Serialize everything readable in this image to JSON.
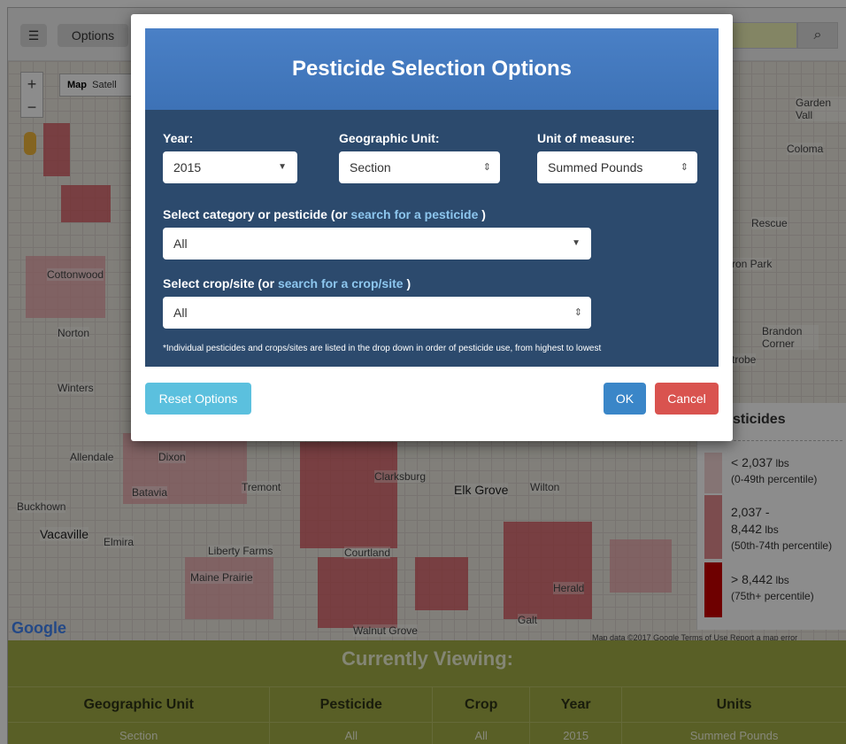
{
  "toolbar": {
    "options_label": "Options",
    "options_icon": "list-icon",
    "search_icon": "search-icon"
  },
  "map": {
    "zoom_in": "+",
    "zoom_out": "−",
    "map_type_map": "Map",
    "map_type_satellite": "Satell",
    "labels": [
      "Garden Vall",
      "Coloma",
      "Rescue",
      "ron Park",
      "Brandon Corner",
      "trobe",
      "Cottonwood",
      "Norton",
      "Winters",
      "Allendale",
      "Dixon",
      "Batavia",
      "Tremont",
      "Buckhown",
      "Vacaville",
      "Elmira",
      "Liberty Farms",
      "Maine Prairie",
      "Elk Grove",
      "Wilton",
      "Clarksburg",
      "Courtland",
      "Herald",
      "Galt",
      "Walnut Grove"
    ],
    "google": "Google",
    "footer": "Map data ©2017 Google   Terms of Use   Report a map error"
  },
  "legend": {
    "title": "sticides",
    "items": [
      {
        "value": "< 2,037",
        "unit": "lbs",
        "range": "(0-49th percentile)",
        "color": "#f3d3d4"
      },
      {
        "value": "2,037 -",
        "value2": "8,442",
        "unit": "lbs",
        "range": "(50th-74th percentile)",
        "color": "#e28a8f"
      },
      {
        "value": "> 8,442",
        "unit": "lbs",
        "range": "(75th+ percentile)",
        "color": "#c80000"
      }
    ]
  },
  "viewing": {
    "title": "Currently Viewing:",
    "headers": [
      "Geographic Unit",
      "Pesticide",
      "Crop",
      "Year",
      "Units"
    ],
    "values": [
      "Section",
      "All",
      "All",
      "2015",
      "Summed Pounds"
    ]
  },
  "modal": {
    "title": "Pesticide Selection Options",
    "year_label": "Year:",
    "year_value": "2015",
    "geo_label": "Geographic Unit:",
    "geo_value": "Section",
    "unit_label": "Unit of measure:",
    "unit_value": "Summed Pounds",
    "category_label_prefix": "Select category or pesticide (or ",
    "category_link": "search for a pesticide",
    "category_label_suffix": " )",
    "category_value": "All",
    "crop_label_prefix": "Select  crop/site (or ",
    "crop_link": "search for a crop/site",
    "crop_label_suffix": " )",
    "crop_value": "All",
    "footnote": "*Individual pesticides and crops/sites are listed in the drop down in order of pesticide use, from highest to lowest",
    "reset_label": "Reset Options",
    "ok_label": "OK",
    "cancel_label": "Cancel"
  },
  "colors": {
    "header_blue": "#4a80c6",
    "body_navy": "#2c4a6d",
    "reset": "#5bc0de",
    "ok": "#3a86c8",
    "cancel": "#d9534f",
    "viewing_green": "#a2ad46"
  }
}
